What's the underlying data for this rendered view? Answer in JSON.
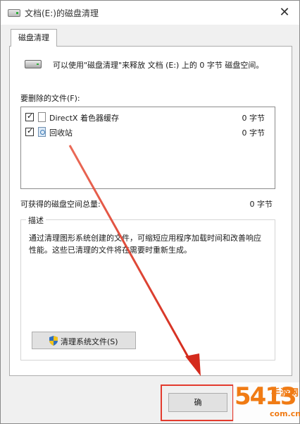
{
  "window": {
    "title": "文档(E:)的磁盘清理",
    "close_glyph": "✕"
  },
  "tabs": [
    {
      "label": "磁盘清理"
    }
  ],
  "info": {
    "message": "可以使用\"磁盘清理\"来释放 文档 (E:) 上的 0 字节 磁盘空间。"
  },
  "files": {
    "label": "要删除的文件(F):",
    "items": [
      {
        "name": "DirectX 着色器缓存",
        "size": "0 字节",
        "checked": true,
        "icon": "file-icon"
      },
      {
        "name": "回收站",
        "size": "0 字节",
        "checked": true,
        "icon": "recycle-bin-icon"
      }
    ]
  },
  "total": {
    "label": "可获得的磁盘空间总量:",
    "value": "0 字节"
  },
  "description": {
    "legend": "描述",
    "text": "通过清理图形系统创建的文件，可缩短应用程序加载时间和改善响应性能。这些已清理的文件将在需要时重新生成。"
  },
  "buttons": {
    "cleanup_system": "清理系统文件(S)",
    "ok": "确"
  },
  "watermark": {
    "big": "5413",
    "sub": "手游网",
    "site": "com.cn"
  },
  "colors": {
    "annotation": "#e33b2e",
    "watermark": "#f07b14"
  }
}
